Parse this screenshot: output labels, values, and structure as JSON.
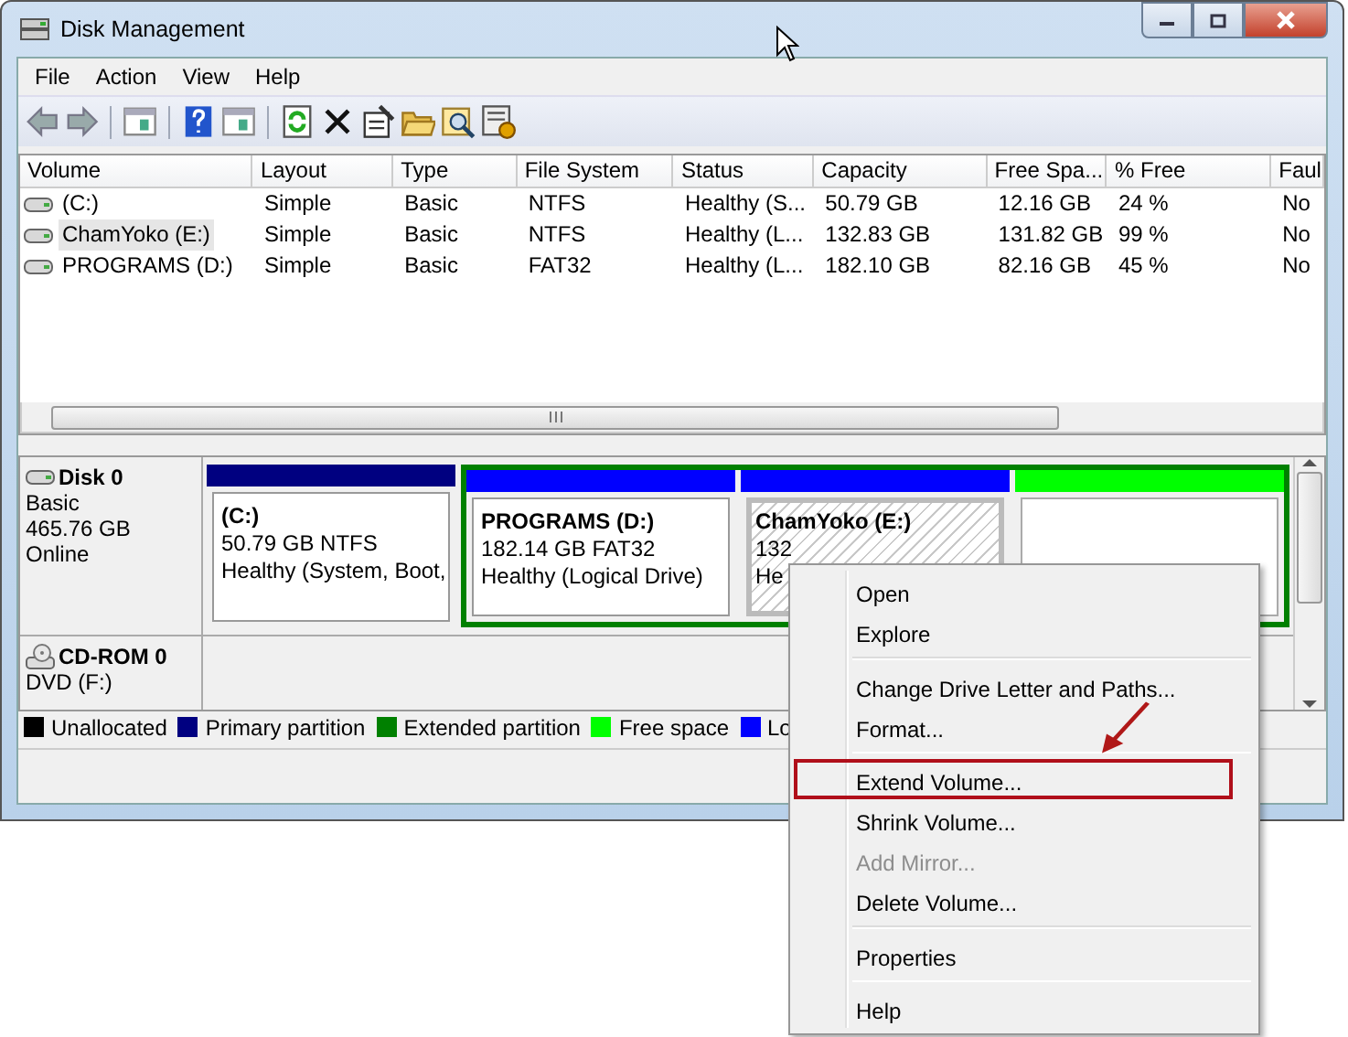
{
  "window": {
    "title": "Disk Management"
  },
  "menu_bar": [
    "File",
    "Action",
    "View",
    "Help"
  ],
  "volume_table": {
    "columns": [
      "Volume",
      "Layout",
      "Type",
      "File System",
      "Status",
      "Capacity",
      "Free Spa...",
      "% Free",
      "Faul"
    ],
    "rows": [
      {
        "selected": false,
        "cells": [
          "(C:)",
          "Simple",
          "Basic",
          "NTFS",
          "Healthy (S...",
          "50.79 GB",
          "12.16 GB",
          "24 %",
          "No"
        ]
      },
      {
        "selected": true,
        "cells": [
          "ChamYoko (E:)",
          "Simple",
          "Basic",
          "NTFS",
          "Healthy (L...",
          "132.83 GB",
          "131.82 GB",
          "99 %",
          "No"
        ]
      },
      {
        "selected": false,
        "cells": [
          "PROGRAMS (D:)",
          "Simple",
          "Basic",
          "FAT32",
          "Healthy (L...",
          "182.10 GB",
          "82.16 GB",
          "45 %",
          "No"
        ]
      }
    ]
  },
  "disks": [
    {
      "kind": "hdd",
      "name": "Disk 0",
      "lines": [
        "Basic",
        "465.76 GB",
        "Online"
      ],
      "partitions": [
        {
          "kind": "primary",
          "color": "#000080",
          "selected": false,
          "lines": [
            "(C:)",
            "50.79 GB NTFS",
            "Healthy (System, Boot,"
          ]
        },
        {
          "kind": "extended",
          "color": "#008000",
          "children": [
            {
              "kind": "logical",
              "color": "#0000ff",
              "selected": false,
              "lines": [
                "PROGRAMS  (D:)",
                "182.14 GB FAT32",
                "Healthy (Logical Drive)"
              ]
            },
            {
              "kind": "logical",
              "color": "#0000ff",
              "selected": true,
              "lines": [
                "ChamYoko  (E:)",
                "132",
                "He"
              ]
            },
            {
              "kind": "free",
              "color": "#00ff00",
              "selected": false
            }
          ]
        }
      ]
    },
    {
      "kind": "cdrom",
      "name": "CD-ROM 0",
      "lines": [
        "DVD (F:)"
      ]
    }
  ],
  "legend": [
    {
      "label": "Unallocated",
      "color": "#000000"
    },
    {
      "label": "Primary partition",
      "color": "#000080"
    },
    {
      "label": "Extended partition",
      "color": "#008000"
    },
    {
      "label": "Free space",
      "color": "#00ff00"
    },
    {
      "label": "Lo",
      "color": "#0000ff"
    }
  ],
  "context_menu": [
    {
      "kind": "item",
      "label": "Open",
      "disabled": false,
      "highlighted": false
    },
    {
      "kind": "item",
      "label": "Explore",
      "disabled": false,
      "highlighted": false
    },
    {
      "kind": "separator"
    },
    {
      "kind": "item",
      "label": "Change Drive Letter and Paths...",
      "disabled": false,
      "highlighted": false
    },
    {
      "kind": "item",
      "label": "Format...",
      "disabled": false,
      "highlighted": false
    },
    {
      "kind": "separator"
    },
    {
      "kind": "item",
      "label": "Extend Volume...",
      "disabled": false,
      "highlighted": true
    },
    {
      "kind": "item",
      "label": "Shrink Volume...",
      "disabled": false,
      "highlighted": false
    },
    {
      "kind": "item",
      "label": "Add Mirror...",
      "disabled": true,
      "highlighted": false
    },
    {
      "kind": "item",
      "label": "Delete Volume...",
      "disabled": false,
      "highlighted": false
    },
    {
      "kind": "separator"
    },
    {
      "kind": "item",
      "label": "Properties",
      "disabled": false,
      "highlighted": false
    },
    {
      "kind": "separator"
    },
    {
      "kind": "item",
      "label": "Help",
      "disabled": false,
      "highlighted": false
    }
  ]
}
